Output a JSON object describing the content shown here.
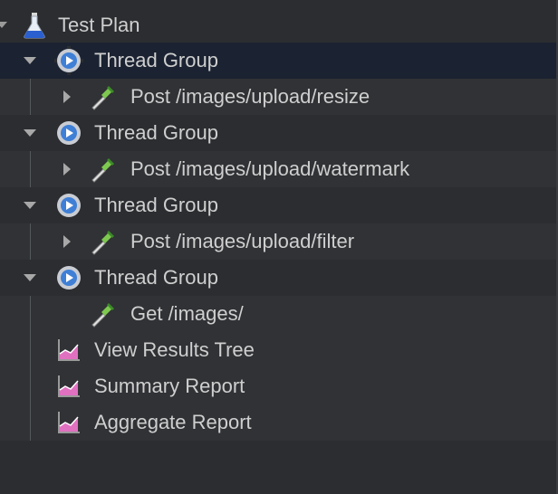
{
  "tree": {
    "root": {
      "label": "Test Plan",
      "icon": "flask-icon"
    },
    "thread_groups": [
      {
        "label": "Thread Group",
        "icon": "gear-icon",
        "expanded": true,
        "selected": true,
        "sampler": {
          "label": "Post /images/upload/resize",
          "icon": "pipette-icon",
          "has_children": true
        }
      },
      {
        "label": "Thread Group",
        "icon": "gear-icon",
        "expanded": true,
        "selected": false,
        "sampler": {
          "label": "Post /images/upload/watermark",
          "icon": "pipette-icon",
          "has_children": true
        }
      },
      {
        "label": "Thread Group",
        "icon": "gear-icon",
        "expanded": true,
        "selected": false,
        "sampler": {
          "label": "Post /images/upload/filter",
          "icon": "pipette-icon",
          "has_children": true
        }
      },
      {
        "label": "Thread Group",
        "icon": "gear-icon",
        "expanded": true,
        "selected": false,
        "sampler": {
          "label": "Get /images/",
          "icon": "pipette-icon",
          "has_children": false
        }
      }
    ],
    "listeners": [
      {
        "label": "View Results Tree",
        "icon": "graph-icon"
      },
      {
        "label": "Summary Report",
        "icon": "graph-icon"
      },
      {
        "label": "Aggregate Report",
        "icon": "graph-icon"
      }
    ]
  },
  "colors": {
    "background": "#2b2d30",
    "row_alt": "#303235",
    "selected_row": "#1b2332",
    "text": "#cfcfcf",
    "gear_blue": "#3f7fd6",
    "pipette_green": "#7ec850",
    "graph_pink": "#e070c0"
  }
}
